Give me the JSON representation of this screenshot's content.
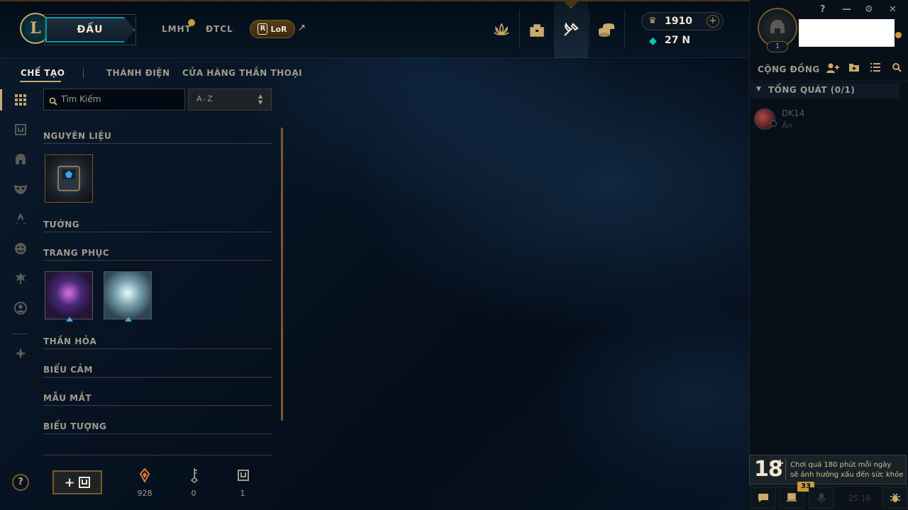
{
  "topbar": {
    "logo_letter": "L",
    "play_label": "ĐẤU",
    "games": [
      "LMHT",
      "ĐTCL"
    ],
    "lor_label": "LoR",
    "lor_letter": "R",
    "ext_arrow": "↗",
    "icons": [
      "home-lotus-icon",
      "profile-bag-icon",
      "collection-crafting-icon",
      "store-coins-icon"
    ],
    "rp_icon": "♛",
    "rp": "1910",
    "rp_plus": "+",
    "be_icon": "◆",
    "be": "27 N"
  },
  "window": {
    "help": "?",
    "minimize": "—",
    "settings": "⚙",
    "close": "✕"
  },
  "profile": {
    "level": "1"
  },
  "subnav": {
    "tabs": [
      "CHẾ TẠO",
      "THÁNH ĐIỆN",
      "CỬA HÀNG THẦN THOẠI"
    ],
    "active": "CHẾ TẠO"
  },
  "sidebar": {
    "icons": [
      "grid-icon",
      "chest-icon",
      "helmet-icon",
      "mask-icon",
      "ward-icon",
      "emote-icon",
      "totem-icon",
      "account-icon",
      "eternals-icon"
    ]
  },
  "filter": {
    "search_icon": "⌕",
    "search_placeholder": "Tìm Kiếm",
    "sort_value": "A-Z",
    "sort_arrows": "▲▼"
  },
  "categories": [
    {
      "label": "NGUYÊN LIỆU"
    },
    {
      "label": "TƯỚNG"
    },
    {
      "label": "TRANG PHỤC"
    },
    {
      "label": "THẦN HỎA"
    },
    {
      "label": "BIỂU CẢM"
    },
    {
      "label": "MẪU MẮT"
    },
    {
      "label": "BIỂU TƯỢNG"
    }
  ],
  "footer": {
    "help": "?",
    "craft_plus": "+",
    "stats": [
      {
        "icon": "orange-essence-icon",
        "value": "928"
      },
      {
        "icon": "key-fragment-icon",
        "value": "0"
      },
      {
        "icon": "chest-icon",
        "value": "1"
      }
    ]
  },
  "social": {
    "title": "CỘNG ĐỒNG",
    "header_icons": [
      "add-friend-icon",
      "add-folder-icon",
      "list-icon",
      "search-icon"
    ],
    "group_caret": "▼",
    "group_label": "TỔNG QUÁT (0/1)",
    "friend": {
      "name": "DK14",
      "status": "Ẩn"
    }
  },
  "warning": {
    "age": "18",
    "plus": "+",
    "line1": "Chơi quá 180 phút mỗi ngày",
    "line2": "sẽ ảnh hưởng xấu đến sức khỏe"
  },
  "bottom": {
    "badge": "33",
    "version": "25.16"
  },
  "colors": {
    "gold": "#c8aa6e",
    "gold_dark": "#785a28",
    "text": "#a09b8c",
    "text_bright": "#f0e6d2",
    "teal": "#0ac8b9",
    "bg": "#010a13"
  }
}
